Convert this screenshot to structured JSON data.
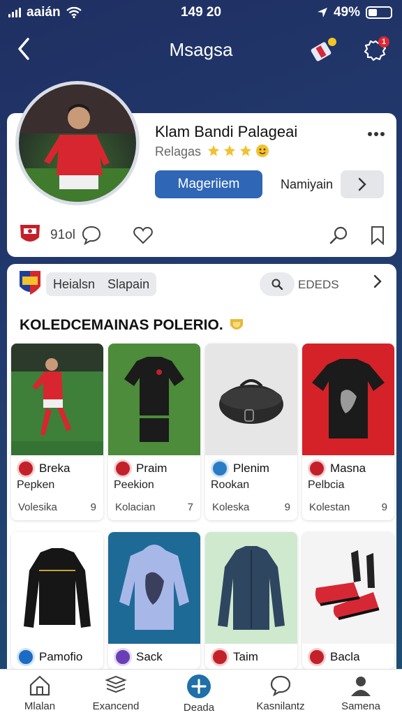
{
  "status": {
    "carrier": "aaián",
    "time": "149 20",
    "battery": "49%"
  },
  "header": {
    "title": "Msagsa"
  },
  "notifications": {
    "badge_count": "1"
  },
  "profile": {
    "name": "Klam Bandi Palageai",
    "subtitle": "Relagas",
    "primary_button": "Mageriiem",
    "secondary_text": "Namiyain",
    "stat_count": "91ol"
  },
  "tabs": {
    "items": [
      "Heialsn",
      "Slapain"
    ],
    "search_label": "EDEDS"
  },
  "section": {
    "title": "KOLEDCEMAINAS POLERIO."
  },
  "items": [
    {
      "name": "Breka",
      "sub": "Pepken",
      "type": "Volesika",
      "count": "9"
    },
    {
      "name": "Praim",
      "sub": "Peekion",
      "type": "Kolacian",
      "count": "7"
    },
    {
      "name": "Plenim",
      "sub": "Rookan",
      "type": "Koleska",
      "count": "9"
    },
    {
      "name": "Masna",
      "sub": "Pelbcia",
      "type": "Kolestan",
      "count": "9"
    },
    {
      "name": "Pamofio"
    },
    {
      "name": "Sack"
    },
    {
      "name": "Taim"
    },
    {
      "name": "Bacla"
    }
  ],
  "bottom_nav": [
    {
      "label": "Mlalan",
      "icon": "home-icon"
    },
    {
      "label": "Exancend",
      "icon": "layers-icon"
    },
    {
      "label": "Deada",
      "icon": "add-icon"
    },
    {
      "label": "Kasnilantz",
      "icon": "chat-icon"
    },
    {
      "label": "Samena",
      "icon": "profile-icon"
    }
  ],
  "colors": {
    "accent": "#2f66b5",
    "background": "#1f2f62",
    "add_button": "#1f6fa8"
  }
}
